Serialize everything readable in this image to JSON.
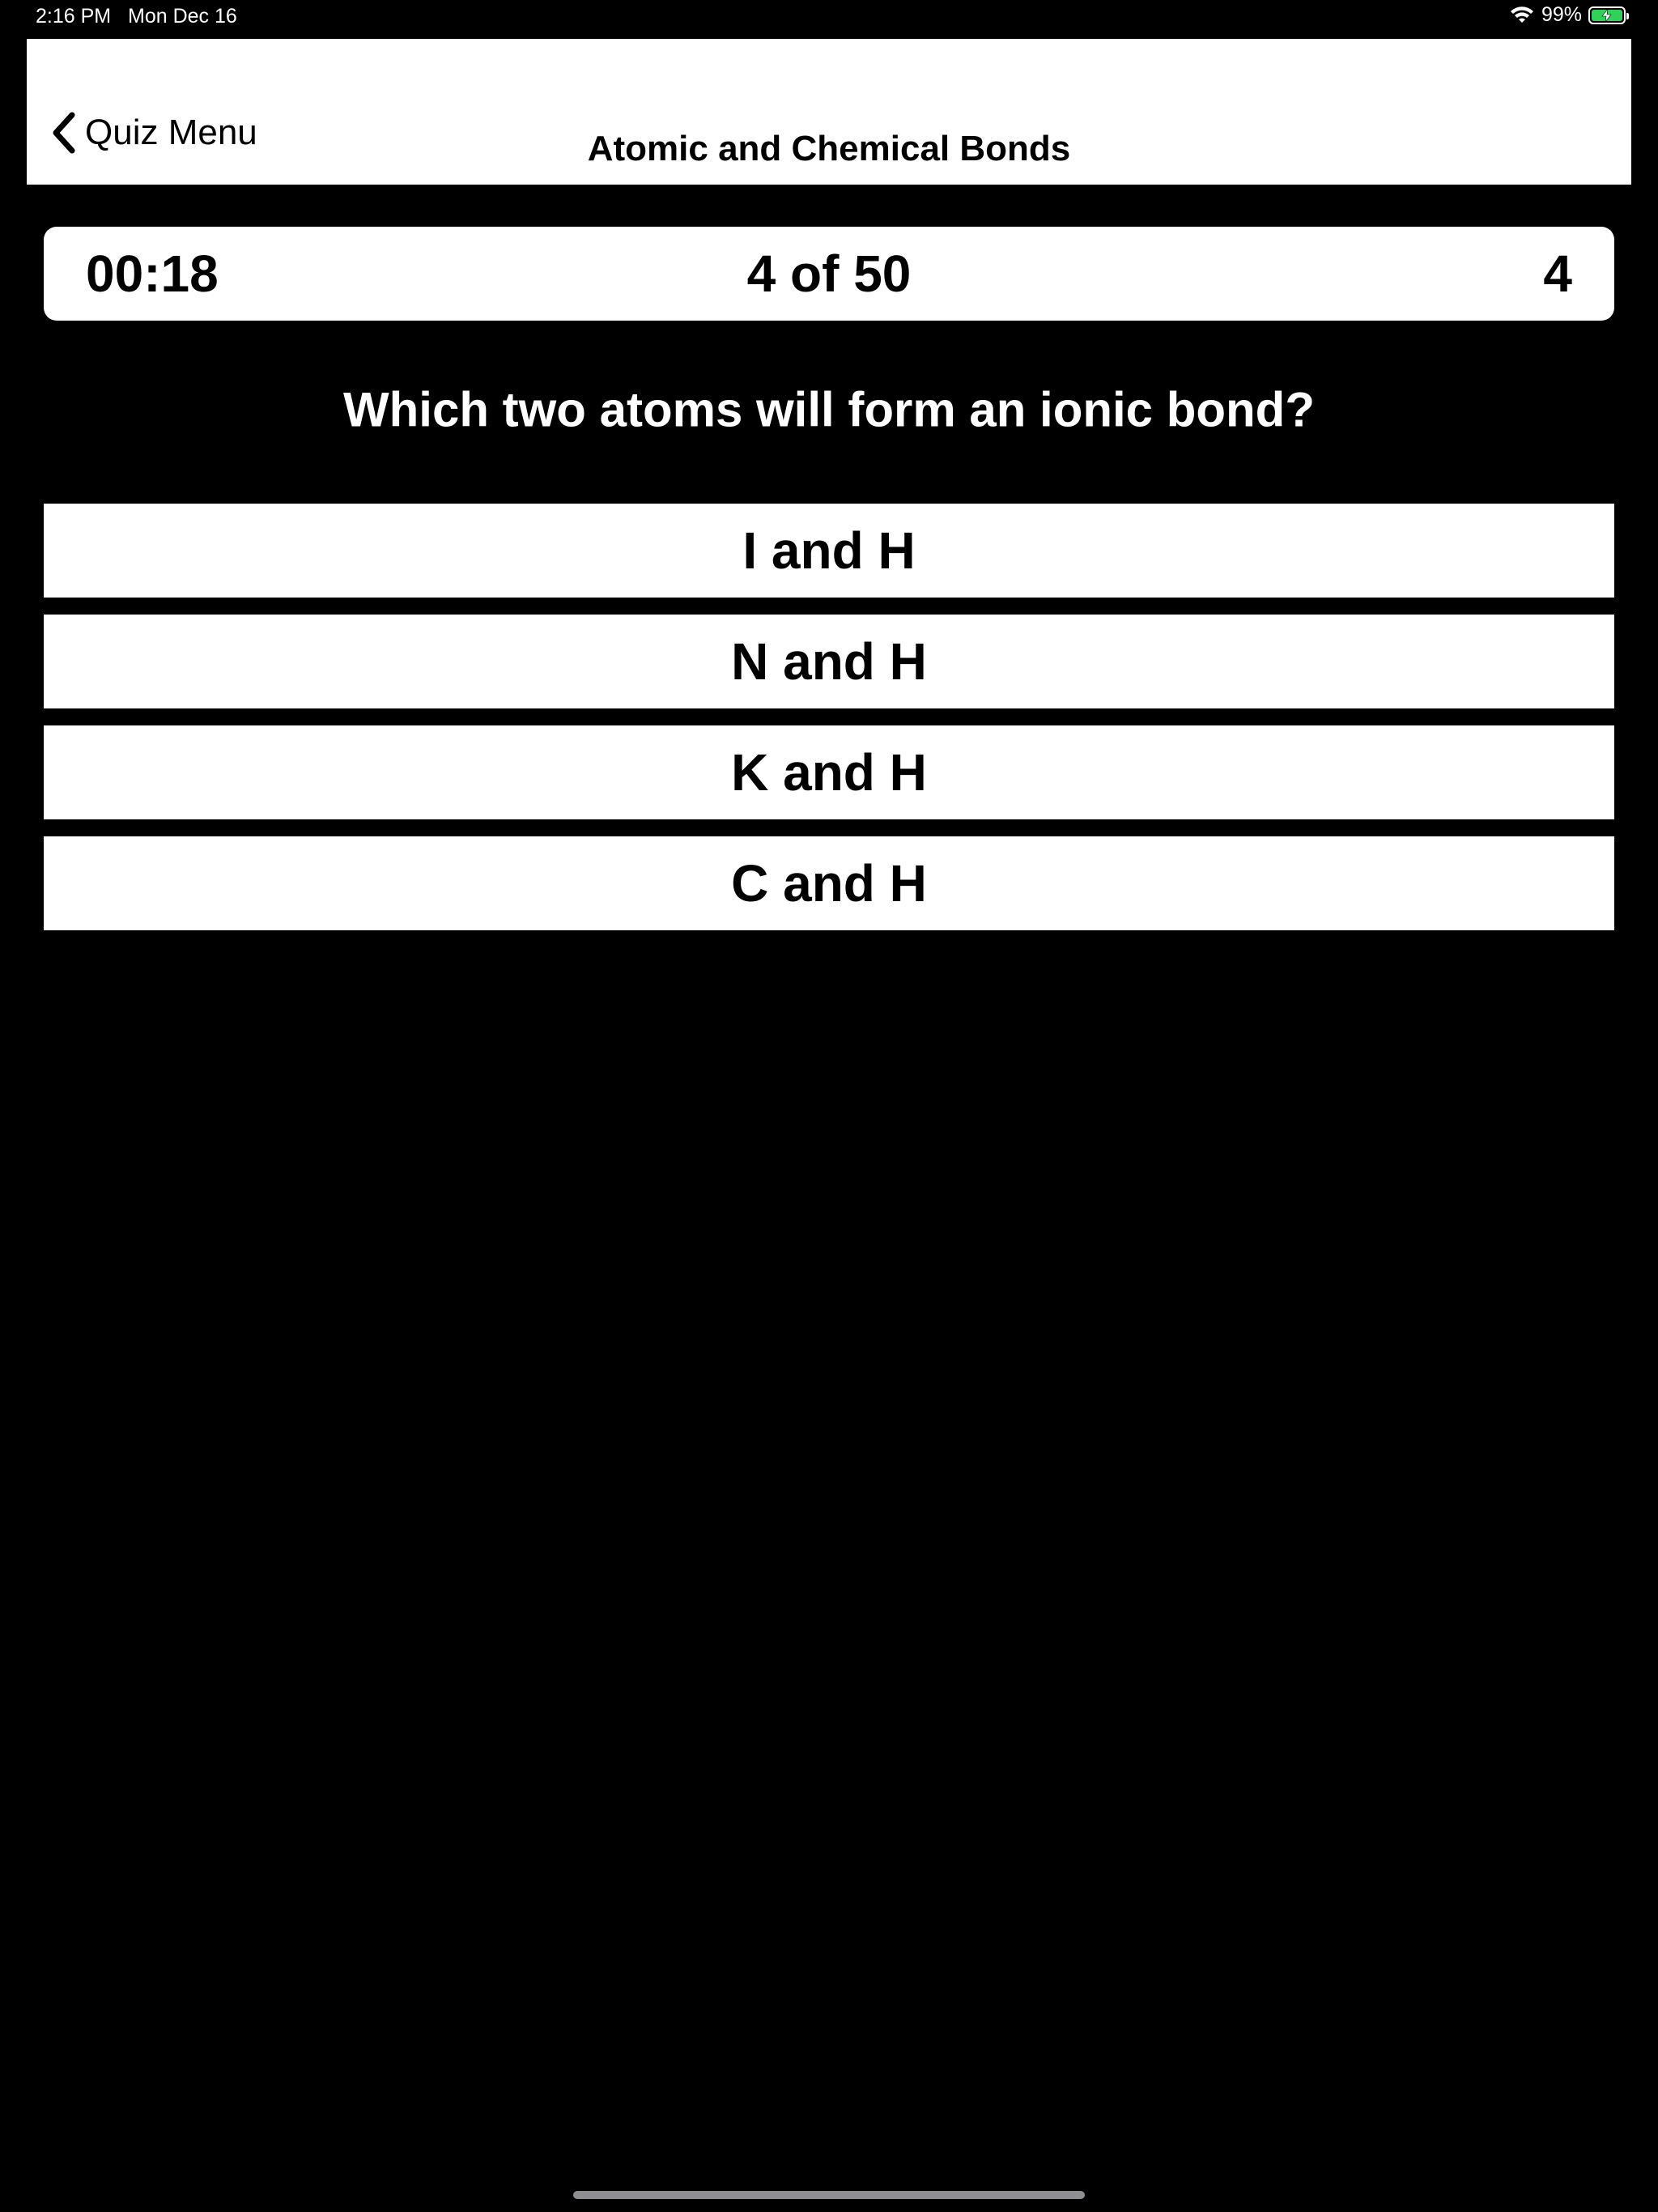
{
  "status_bar": {
    "time": "2:16 PM",
    "date": "Mon Dec 16",
    "battery_percent": "99%",
    "battery_level": 0.99,
    "battery_color": "#30d158",
    "icons": [
      "wifi-icon",
      "battery-charging-icon"
    ]
  },
  "nav": {
    "back_label": "Quiz Menu",
    "back_icon": "chevron-left-icon",
    "title": "Atomic and Chemical Bonds"
  },
  "quiz": {
    "timer": "00:18",
    "progress": "4 of 50",
    "score": "4",
    "question": "Which two atoms will form an ionic bond?",
    "answers": [
      {
        "label": "I and H"
      },
      {
        "label": "N and H"
      },
      {
        "label": "K and H"
      },
      {
        "label": "C and H"
      }
    ]
  },
  "colors": {
    "background": "#000000",
    "panel": "#ffffff",
    "text_on_panel": "#000000",
    "text_on_background": "#ffffff"
  }
}
